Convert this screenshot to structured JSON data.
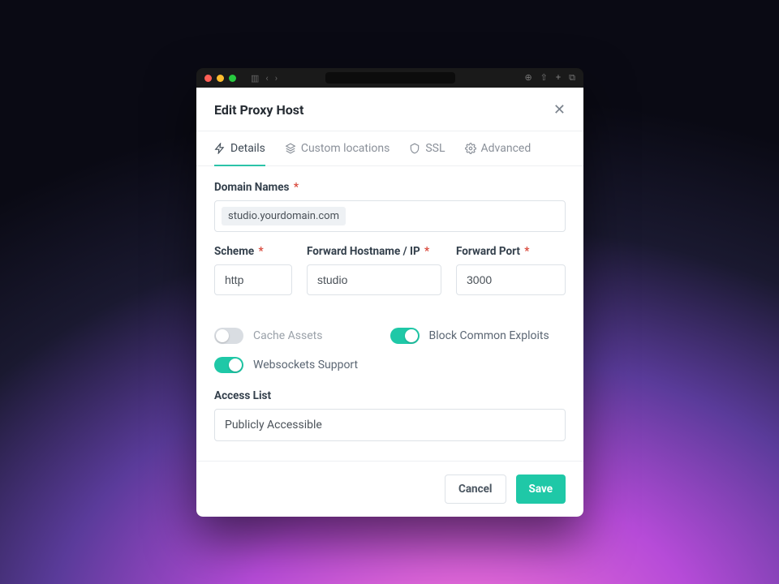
{
  "modal": {
    "title": "Edit Proxy Host",
    "tabs": {
      "details": "Details",
      "custom_locations": "Custom locations",
      "ssl": "SSL",
      "advanced": "Advanced"
    },
    "labels": {
      "domain_names": "Domain Names",
      "scheme": "Scheme",
      "forward_host": "Forward Hostname / IP",
      "forward_port": "Forward Port",
      "access_list": "Access List"
    },
    "values": {
      "domain_name_chip": "studio.yourdomain.com",
      "scheme": "http",
      "forward_host": "studio",
      "forward_port": "3000",
      "access_list": "Publicly Accessible"
    },
    "toggles": {
      "cache_assets": {
        "label": "Cache Assets",
        "on": false
      },
      "block_exploits": {
        "label": "Block Common Exploits",
        "on": true
      },
      "websockets": {
        "label": "Websockets Support",
        "on": true
      }
    },
    "buttons": {
      "cancel": "Cancel",
      "save": "Save"
    }
  }
}
